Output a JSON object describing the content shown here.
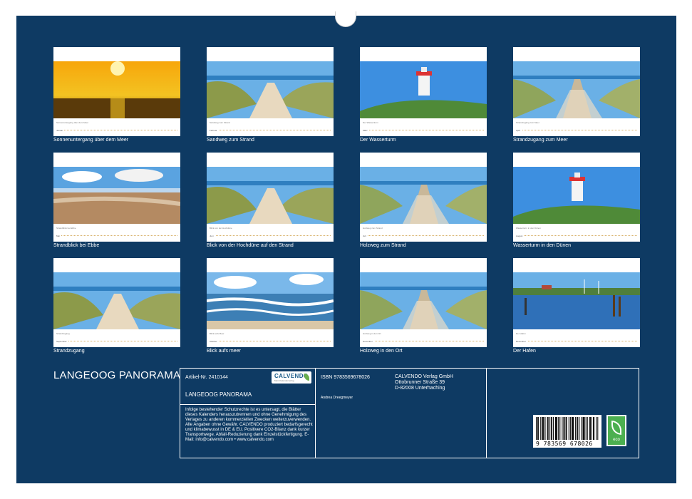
{
  "calendar": {
    "title": "LANGEOOG PANORAMA",
    "months": [
      {
        "label": "Sonnenuntergang über dem Meer",
        "mini_caption": "Sonnenuntergang über dem Meer",
        "month": "Januar",
        "scene": "sunset"
      },
      {
        "label": "Sandweg zum Strand",
        "mini_caption": "Sandweg zum Strand",
        "month": "Februar",
        "scene": "dunepath"
      },
      {
        "label": "Der Wasserturm",
        "mini_caption": "Der Wasserturm",
        "month": "März",
        "scene": "tower"
      },
      {
        "label": "Strandzugang zum Meer",
        "mini_caption": "Strandzugang zum Meer",
        "month": "April",
        "scene": "boardwalk"
      },
      {
        "label": "Strandblick bei Ebbe",
        "mini_caption": "Strandblick bei Ebbe",
        "month": "Mai",
        "scene": "ebbe"
      },
      {
        "label": "Blick von der Hochdüne auf den Strand",
        "mini_caption": "Blick von der Hochdüne",
        "month": "Juni",
        "scene": "dunepath"
      },
      {
        "label": "Holzweg zum Strand",
        "mini_caption": "Holzweg zum Strand",
        "month": "Juli",
        "scene": "boardwalk"
      },
      {
        "label": "Wasserturm in den Dünen",
        "mini_caption": "Wasserturm in den Dünen",
        "month": "August",
        "scene": "tower"
      },
      {
        "label": "Strandzugang",
        "mini_caption": "Strandzugang",
        "month": "September",
        "scene": "dunepath"
      },
      {
        "label": "Blick aufs meer",
        "mini_caption": "Blick aufs Meer",
        "month": "Oktober",
        "scene": "waves"
      },
      {
        "label": "Holzweg in den Ort",
        "mini_caption": "Holzweg in den Ort",
        "month": "November",
        "scene": "boardwalk"
      },
      {
        "label": "Der Hafen",
        "mini_caption": "Der Hafen",
        "month": "Dezember",
        "scene": "harbor"
      }
    ]
  },
  "info": {
    "artikel": "Artikel-Nr. 2410144",
    "logo_text": "CALVENDO",
    "logo_sub": "Mein Kalenderverlag",
    "subtitle": "LANGEOOG PANORAMA",
    "legal": "Infolge bestehender Schutzrechte ist es untersagt, die Blätter dieses Kalenders herauszutrennen und ohne Genehmigung des Verlages zu anderen kommerziellen Zwecken weiterzuverwenden. Alle Angaben ohne Gewähr. CALVENDO produziert bedarfsgerecht und klimabewusst in DE & EU. Positivere CO2-Bilanz dank kurzer Transportwege. Abfall-Reduzierung dank Einzelstückfertigung. E-Mail: info@calvendo.com • www.calvendo.com",
    "isbn": "ISBN 9783569678026",
    "author": "Andrea Dreegmeyer",
    "publisher_line1": "CALVENDO Verlag GmbH",
    "publisher_line2": "Ottobrunner Straße 39",
    "publisher_line3": "D-82008 Unterhaching",
    "barcode_number": "9 783569 678026",
    "eco_label": "eco"
  },
  "colors": {
    "background": "#0e3a63",
    "accent_green": "#4caf50"
  }
}
